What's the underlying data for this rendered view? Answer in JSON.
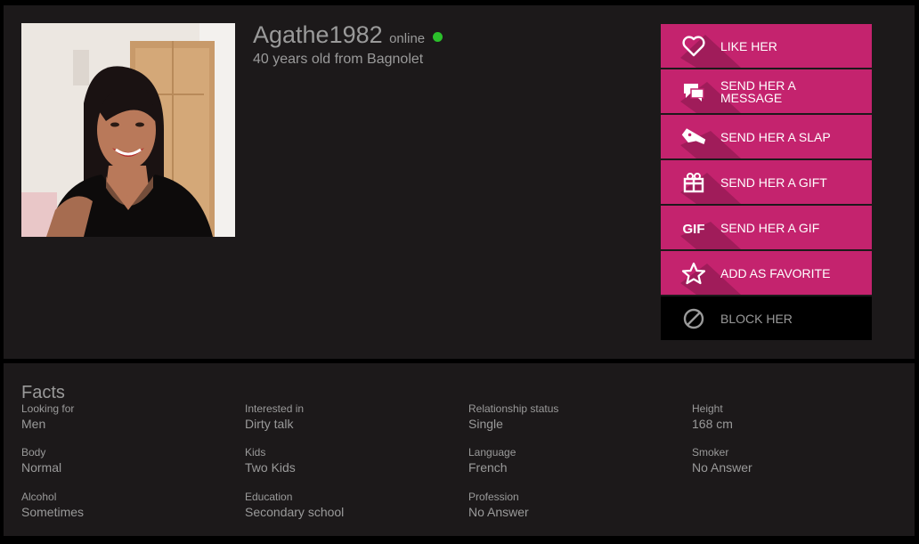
{
  "profile": {
    "username": "Agathe1982",
    "status_text": "online",
    "subtitle": "40 years old from Bagnolet",
    "status_color": "#2bbf2b"
  },
  "actions": [
    {
      "label": "LIKE HER",
      "icon": "heart-icon"
    },
    {
      "label": "SEND HER A MESSAGE",
      "icon": "chat-icon"
    },
    {
      "label": "SEND HER A SLAP",
      "icon": "slap-hand-icon"
    },
    {
      "label": "SEND HER A GIFT",
      "icon": "gift-icon"
    },
    {
      "label": "SEND HER A GIF",
      "icon": "gif-icon"
    },
    {
      "label": "ADD AS FAVORITE",
      "icon": "star-icon"
    },
    {
      "label": "BLOCK HER",
      "icon": "block-icon"
    }
  ],
  "facts": {
    "title": "Facts",
    "items": [
      {
        "key": "Looking for",
        "value": "Men"
      },
      {
        "key": "Interested in",
        "value": "Dirty talk"
      },
      {
        "key": "Relationship status",
        "value": "Single"
      },
      {
        "key": "Height",
        "value": "168 cm"
      },
      {
        "key": "Body",
        "value": "Normal"
      },
      {
        "key": "Kids",
        "value": "Two Kids"
      },
      {
        "key": "Language",
        "value": "French"
      },
      {
        "key": "Smoker",
        "value": "No Answer"
      },
      {
        "key": "Alcohol",
        "value": "Sometimes"
      },
      {
        "key": "Education",
        "value": "Secondary school"
      },
      {
        "key": "Profession",
        "value": "No Answer"
      }
    ]
  },
  "colors": {
    "accent": "#c4236e",
    "panel": "#1c191a",
    "text": "#9a9a9a"
  }
}
